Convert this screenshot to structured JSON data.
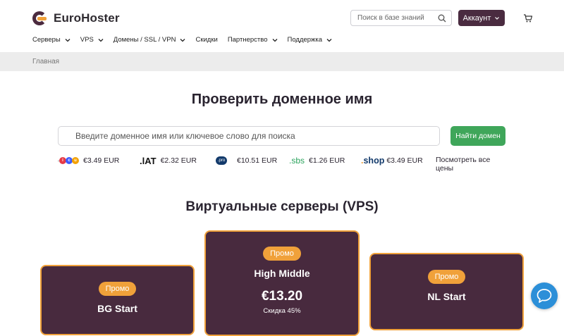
{
  "header": {
    "logo_text": "EuroHoster",
    "search_placeholder": "Поиск в базе знаний",
    "account_label": "Аккаунт"
  },
  "nav": {
    "items": [
      {
        "label": "Серверы",
        "dropdown": true
      },
      {
        "label": "VPS",
        "dropdown": true
      },
      {
        "label": "Домены / SSL / VPN",
        "dropdown": true
      },
      {
        "label": "Скидки",
        "dropdown": false
      },
      {
        "label": "Партнерство",
        "dropdown": true
      },
      {
        "label": "Поддержка",
        "dropdown": true
      }
    ]
  },
  "breadcrumb": {
    "home": "Главная"
  },
  "domain": {
    "title": "Проверить доменное имя",
    "input_placeholder": "Введите доменное имя или ключевое слово для поиска",
    "find_label": "Найти домен",
    "tlds": [
      {
        "name": ".icu",
        "price": "€3.49 EUR"
      },
      {
        "name": ".lat",
        "price": "€2.32 EUR"
      },
      {
        "name": ".pro",
        "price": "€10.51 EUR"
      },
      {
        "name": ".sbs",
        "price": "€1.26 EUR"
      },
      {
        "name": ".shop",
        "price": "€3.49 EUR"
      }
    ],
    "see_all": "Посмотреть все цены"
  },
  "vps": {
    "title": "Виртуальные серверы (VPS)",
    "cards": [
      {
        "promo": "Промо",
        "name": "BG Start"
      },
      {
        "promo": "Промо",
        "name": "High Middle",
        "price": "€13.20",
        "discount": "Скидка 45%"
      },
      {
        "promo": "Промо",
        "name": "NL Start"
      }
    ]
  },
  "colors": {
    "brand": "#482a3e",
    "accent": "#f0a13a",
    "success": "#3fa65a",
    "chat": "#2c8fd8"
  }
}
